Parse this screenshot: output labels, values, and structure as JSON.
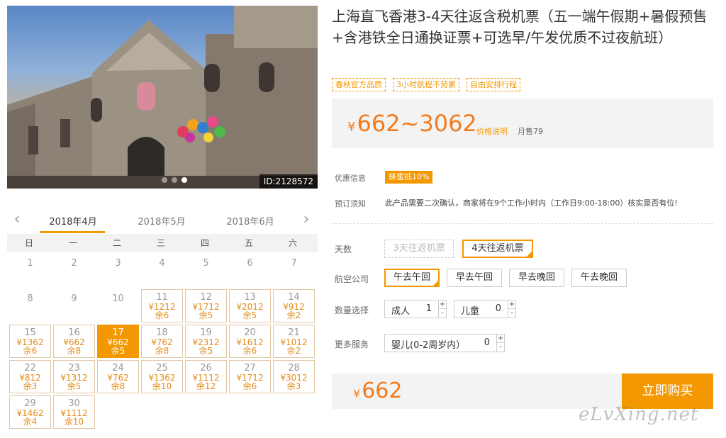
{
  "product": {
    "title": "上海直飞香港3-4天往返含税机票（五一端午假期+暑假预售+含港铁全日通换证票+可选早/午发优质不过夜航班）",
    "tags": [
      "春秋官方品质",
      "3小时航程不劳累",
      "自由安排行程"
    ],
    "price_currency": "¥",
    "price_range": "662~3062",
    "price_link": "价格说明",
    "monthly_sales": "月售79",
    "photo_id": "ID:2128572"
  },
  "calendar": {
    "months": [
      "2018年4月",
      "2018年5月",
      "2018年6月"
    ],
    "active_month": 0,
    "weekdays": [
      "日",
      "一",
      "二",
      "三",
      "四",
      "五",
      "六"
    ],
    "days": [
      {
        "d": "1"
      },
      {
        "d": "2"
      },
      {
        "d": "3"
      },
      {
        "d": "4"
      },
      {
        "d": "5"
      },
      {
        "d": "6"
      },
      {
        "d": "7"
      },
      {
        "d": "8"
      },
      {
        "d": "9"
      },
      {
        "d": "10"
      },
      {
        "d": "11",
        "price": "¥1212",
        "left": "余6"
      },
      {
        "d": "12",
        "price": "¥1712",
        "left": "余5"
      },
      {
        "d": "13",
        "price": "¥2012",
        "left": "余5"
      },
      {
        "d": "14",
        "price": "¥912",
        "left": "余2"
      },
      {
        "d": "15",
        "price": "¥1362",
        "left": "余6"
      },
      {
        "d": "16",
        "price": "¥662",
        "left": "余8"
      },
      {
        "d": "17",
        "price": "¥662",
        "left": "余5",
        "selected": true
      },
      {
        "d": "18",
        "price": "¥762",
        "left": "余8"
      },
      {
        "d": "19",
        "price": "¥2312",
        "left": "余5"
      },
      {
        "d": "20",
        "price": "¥1612",
        "left": "余6"
      },
      {
        "d": "21",
        "price": "¥1012",
        "left": "余2"
      },
      {
        "d": "22",
        "price": "¥812",
        "left": "余3"
      },
      {
        "d": "23",
        "price": "¥1312",
        "left": "余5"
      },
      {
        "d": "24",
        "price": "¥762",
        "left": "余8"
      },
      {
        "d": "25",
        "price": "¥1362",
        "left": "余10"
      },
      {
        "d": "26",
        "price": "¥1112",
        "left": "余12"
      },
      {
        "d": "27",
        "price": "¥1712",
        "left": "余6"
      },
      {
        "d": "28",
        "price": "¥3012",
        "left": "余3"
      },
      {
        "d": "29",
        "price": "¥1462",
        "left": "余4"
      },
      {
        "d": "30",
        "price": "¥1112",
        "left": "余10"
      }
    ]
  },
  "info": {
    "discount_label": "优惠信息",
    "discount_badge": "蜂蜜抵10%",
    "notice_label": "预订须知",
    "notice_text": "此产品需要二次确认，商家将在9个工作小时内（工作日9:00-18:00）核实是否有位!"
  },
  "options": {
    "days_label": "天数",
    "days": [
      {
        "label": "3天往返机票",
        "state": "disabled"
      },
      {
        "label": "4天往返机票",
        "state": "selected"
      }
    ],
    "airline_label": "航空公司",
    "airlines": [
      {
        "label": "午去午回",
        "state": "selected"
      },
      {
        "label": "早去午回",
        "state": "normal"
      },
      {
        "label": "早去晚回",
        "state": "normal"
      },
      {
        "label": "午去晚回",
        "state": "normal"
      }
    ],
    "qty_label": "数量选择",
    "adult_label": "成人",
    "adult_value": "1",
    "child_label": "儿童",
    "child_value": "0",
    "more_label": "更多服务",
    "infant_label": "婴儿(0-2周岁内）",
    "infant_value": "0",
    "plus": "+",
    "minus": "-"
  },
  "footer": {
    "total_currency": "¥",
    "total_price": "662",
    "buy_label": "立即购买",
    "watermark": "eLvXing.net"
  },
  "colors": {
    "accent": "#f39800",
    "price": "#f37b1d"
  }
}
